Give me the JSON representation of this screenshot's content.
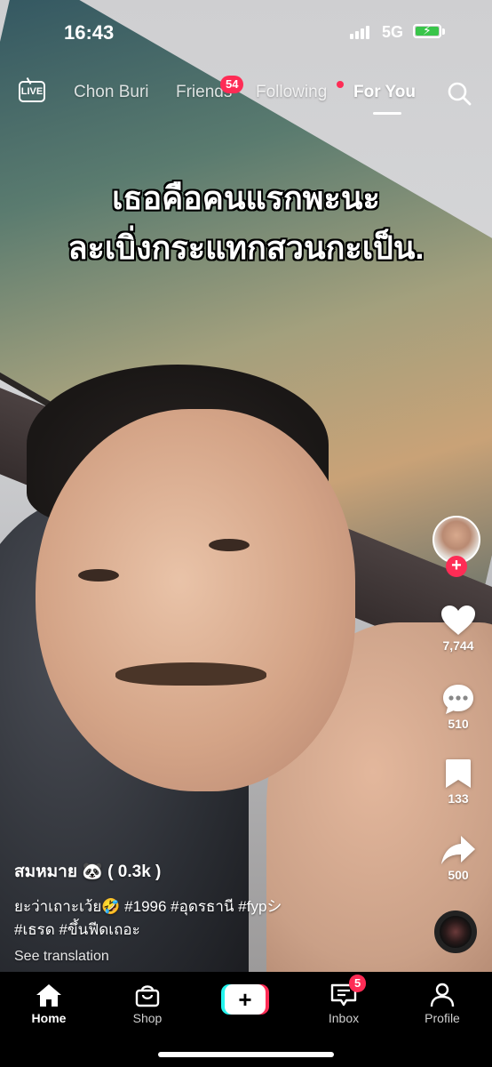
{
  "status_bar": {
    "time": "16:43",
    "network": "5G"
  },
  "top_nav": {
    "live_label": "LIVE",
    "tabs": [
      {
        "label": "Chon Buri"
      },
      {
        "label": "Friends",
        "badge": "54"
      },
      {
        "label": "Following"
      },
      {
        "label": "For You"
      }
    ]
  },
  "video": {
    "caption_line1": "เธอคือคนแรกพะนะ",
    "caption_line2": "ละเบิ่งกระแทกสวนกะเป็น."
  },
  "creator": {
    "username": "สมหมาย 🐼 ( 0.3k )"
  },
  "post": {
    "description_line1": "ยะว่าเถาะเว้ย🤣  #1996 #อุดรธานี #fypシ",
    "description_line2": "#เธรด #ขึ้นฟีดเถอะ",
    "see_translation": "See translation"
  },
  "actions": {
    "likes": "7,744",
    "comments": "510",
    "saves": "133",
    "shares": "500"
  },
  "bottom_nav": {
    "tabs": [
      {
        "label": "Home"
      },
      {
        "label": "Shop"
      },
      {
        "label": "Inbox",
        "badge": "5"
      },
      {
        "label": "Profile"
      }
    ]
  },
  "colors": {
    "accent": "#fe2c55",
    "cyan": "#25f4ee",
    "battery": "#39c54a"
  }
}
